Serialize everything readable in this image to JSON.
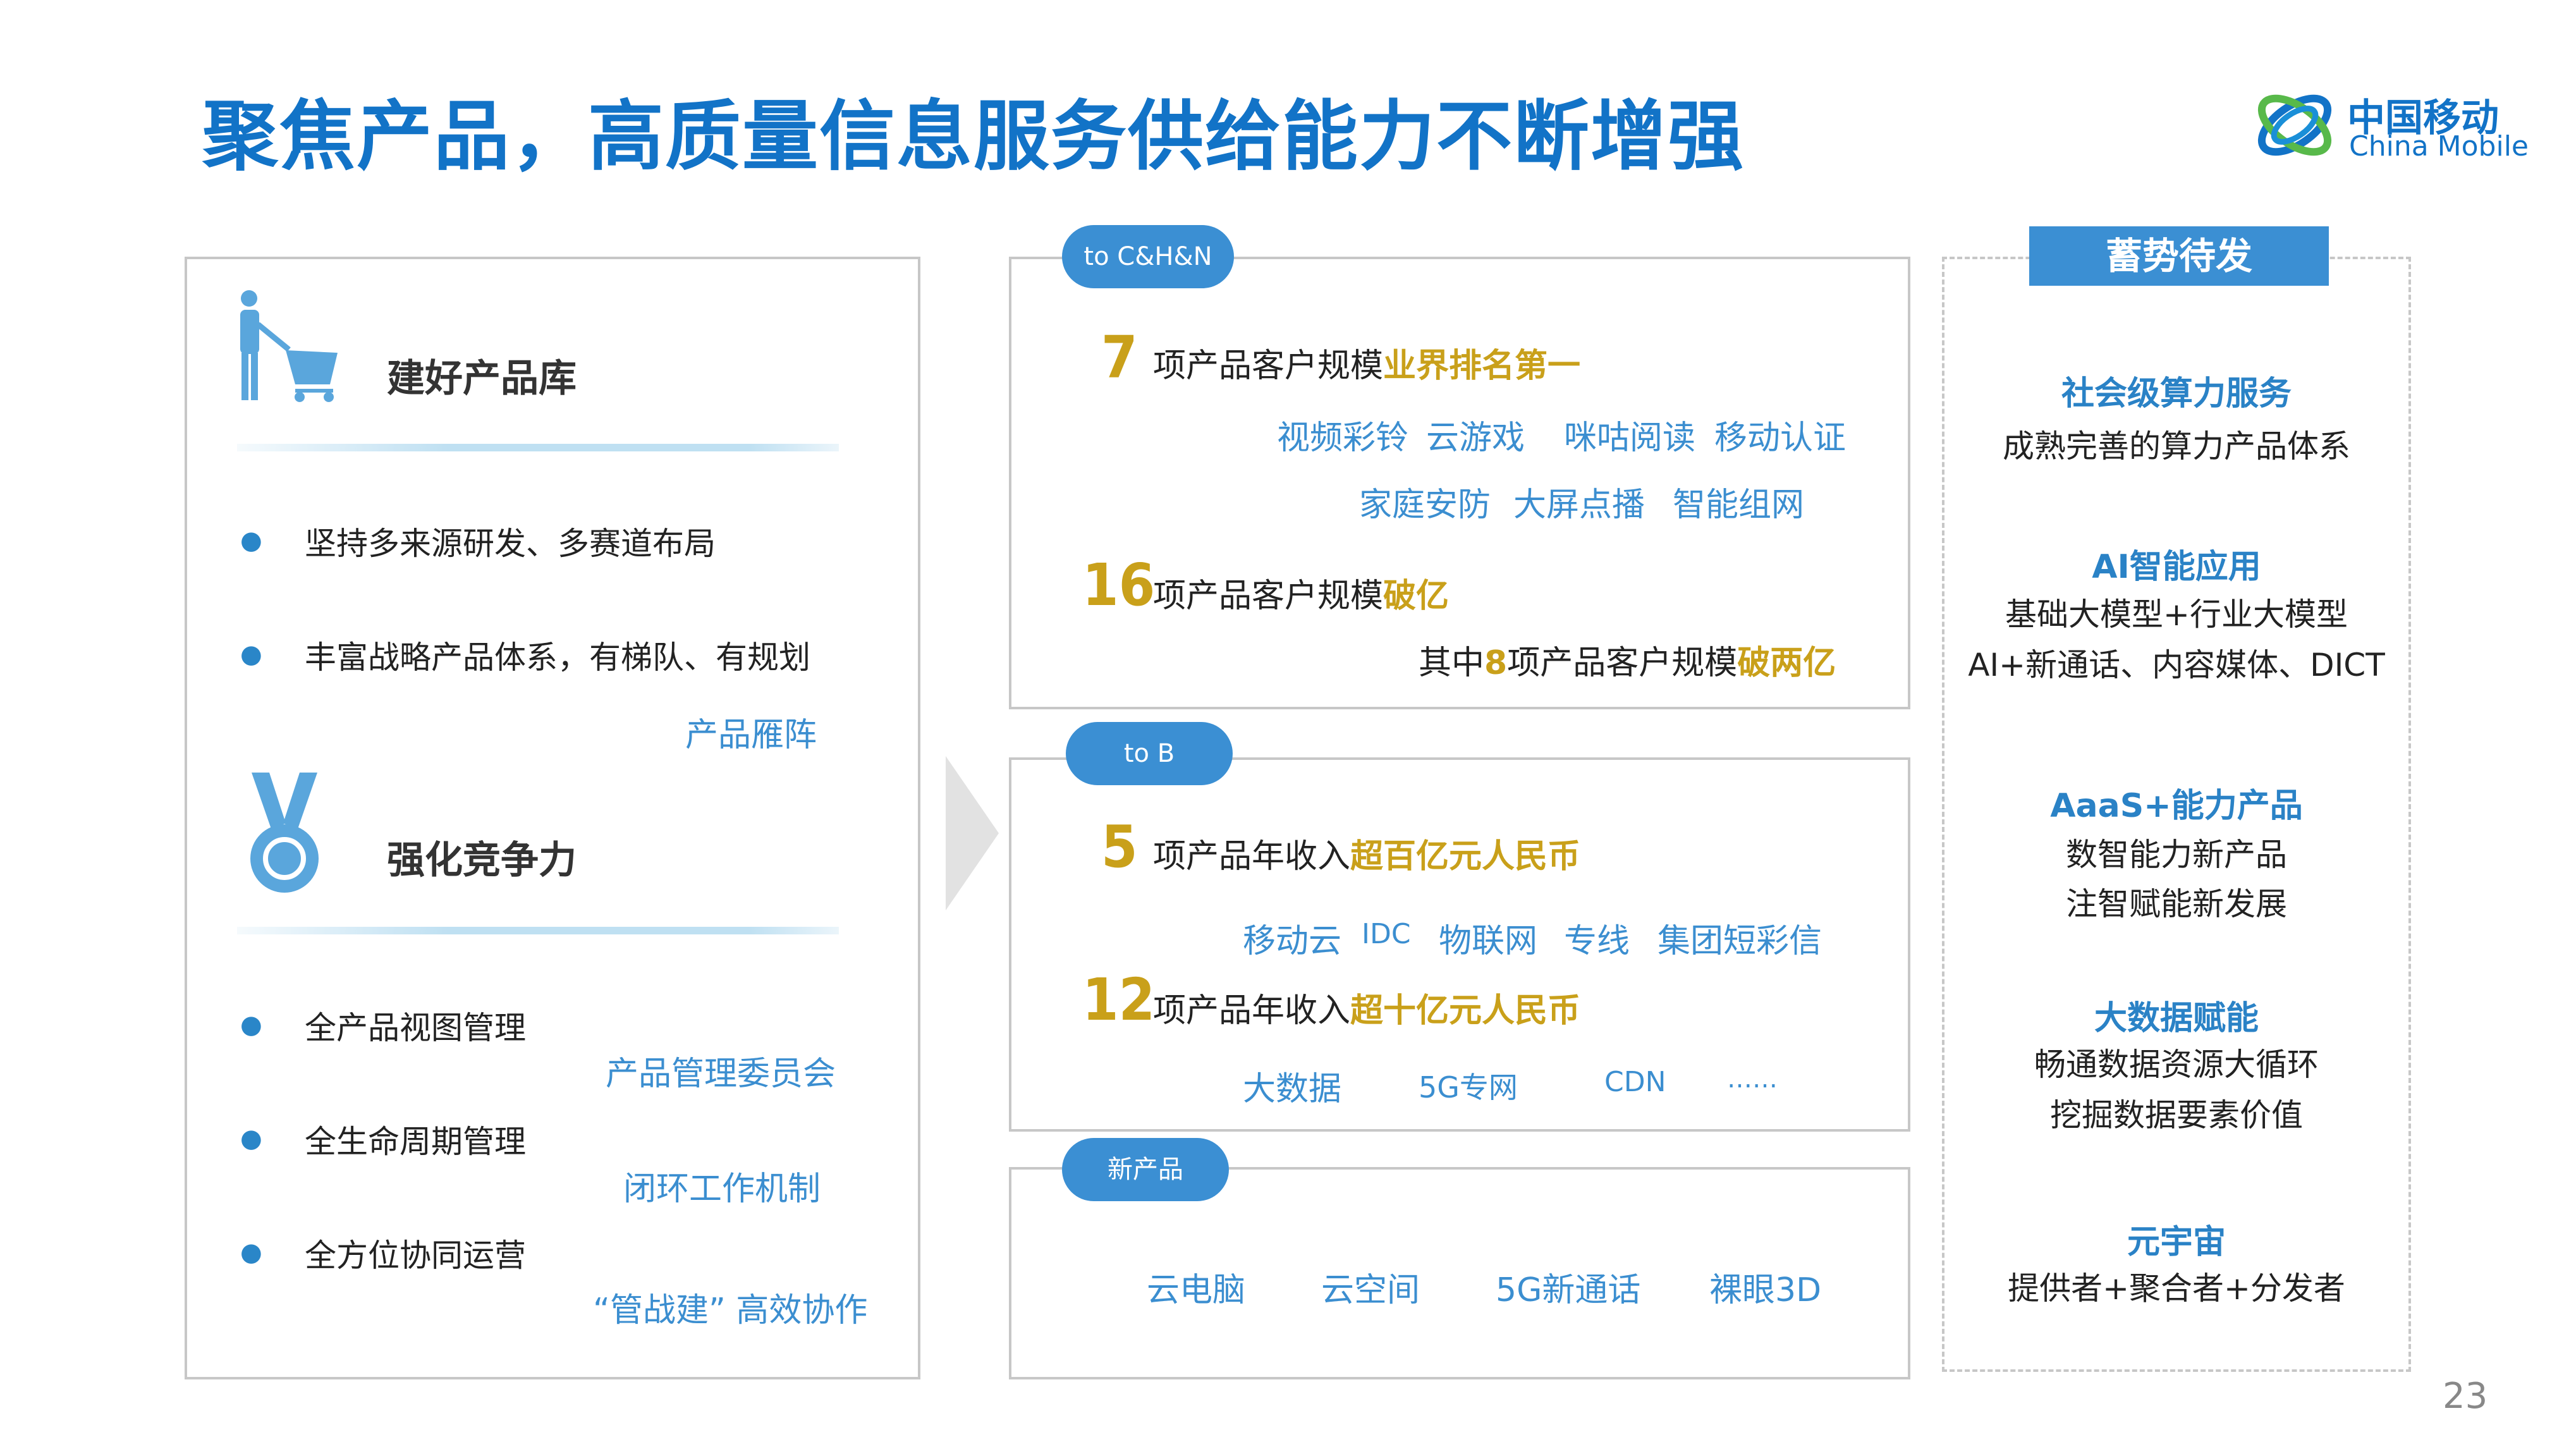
{
  "header": {
    "title": "聚焦产品，高质量信息服务供给能力不断增强",
    "logo_cn": "中国移动",
    "logo_en": "China Mobile"
  },
  "left": {
    "section1": {
      "title": "建好产品库",
      "bullets": [
        "坚持多来源研发、多赛道布局",
        "丰富战略产品体系，有梯队、有规划"
      ],
      "tag": "产品雁阵"
    },
    "section2": {
      "title": "强化竞争力",
      "bullets": [
        {
          "text": "全产品视图管理",
          "tag": "产品管理委员会"
        },
        {
          "text": "全生命周期管理",
          "tag": "闭环工作机制"
        },
        {
          "text": "全方位协同运营",
          "tag": "“管战建”  高效协作"
        }
      ]
    }
  },
  "middle": {
    "ch": {
      "pill": "to C&H&N",
      "stat1": {
        "num": "7",
        "text": "项产品客户规模",
        "highlight": "业界排名第一"
      },
      "row1": [
        "视频彩铃",
        "云游戏",
        "咪咕阅读",
        "移动认证"
      ],
      "row2": [
        "家庭安防",
        "大屏点播",
        "智能组网"
      ],
      "stat2": {
        "num": "16",
        "text": "项产品客户规模",
        "highlight": "破亿"
      },
      "sub": {
        "pre": "其中",
        "num": "8",
        "mid": "项产品客户规模",
        "highlight": "破两亿"
      }
    },
    "b": {
      "pill": "to B",
      "stat1": {
        "num": "5",
        "text": "项产品年收入",
        "highlight": "超百亿元人民币"
      },
      "row1": [
        "移动云",
        "IDC",
        "物联网",
        "专线",
        "集团短彩信"
      ],
      "stat2": {
        "num": "12",
        "text": "项产品年收入",
        "highlight": "超十亿元人民币"
      },
      "row2": [
        "大数据",
        "5G专网",
        "CDN",
        "……"
      ]
    },
    "new": {
      "pill": "新产品",
      "items": [
        "云电脑",
        "云空间",
        "5G新通话",
        "裸眼3D"
      ]
    }
  },
  "right": {
    "title": "蓄势待发",
    "groups": [
      {
        "head": "社会级算力服务",
        "lines": [
          "成熟完善的算力产品体系"
        ]
      },
      {
        "head": "AI智能应用",
        "lines": [
          "基础大模型+行业大模型",
          "AI+新通话、内容媒体、DICT"
        ]
      },
      {
        "head": "AaaS+能力产品",
        "lines": [
          "数智能力新产品",
          "注智赋能新发展"
        ]
      },
      {
        "head": "大数据赋能",
        "lines": [
          "畅通数据资源大循环",
          "挖掘数据要素价值"
        ]
      },
      {
        "head": "元宇宙",
        "lines": [
          "提供者+聚合者+分发者"
        ]
      }
    ]
  },
  "footer": {
    "page": "23"
  },
  "colors": {
    "title_blue": "#1273c7",
    "accent_blue": "#3b8fd3",
    "gold": "#c9a01a",
    "border": "#c7c7c7"
  }
}
